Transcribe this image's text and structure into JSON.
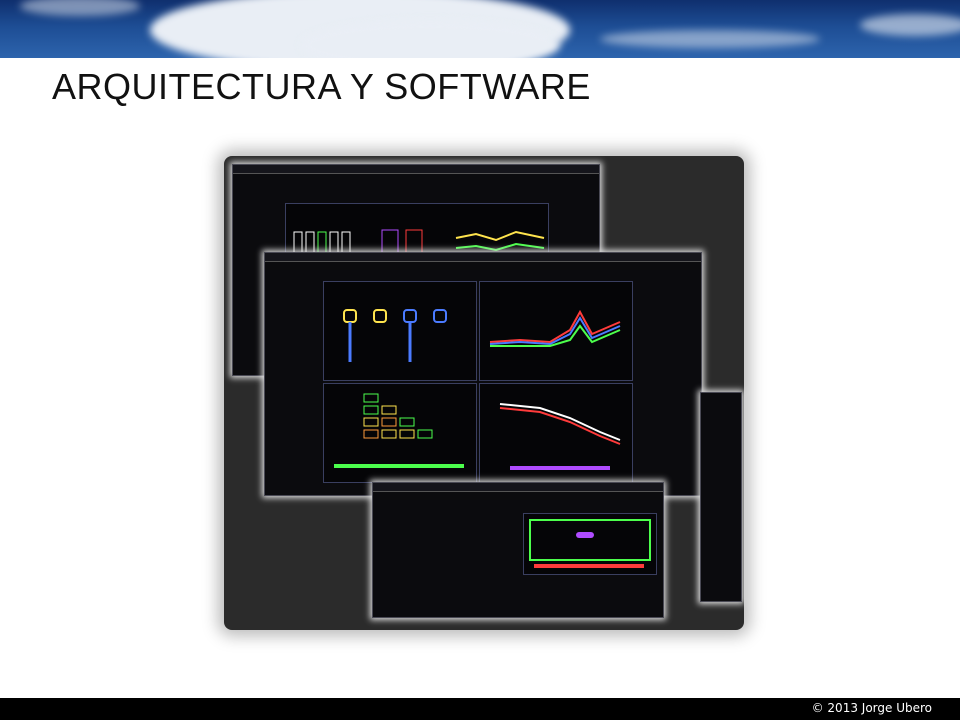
{
  "slide": {
    "title": "ARQUITECTURA Y SOFTWARE",
    "copyright": "© 2013 Jorge Ubero"
  },
  "screenshot": {
    "description_icon": "software-windows-collage",
    "colors": {
      "background": "#0b0b0e",
      "accent_green": "#4cff4c",
      "accent_yellow": "#ffe44d",
      "accent_red": "#ff3b3b",
      "accent_blue": "#4b7bff",
      "accent_purple": "#b04cff"
    }
  }
}
